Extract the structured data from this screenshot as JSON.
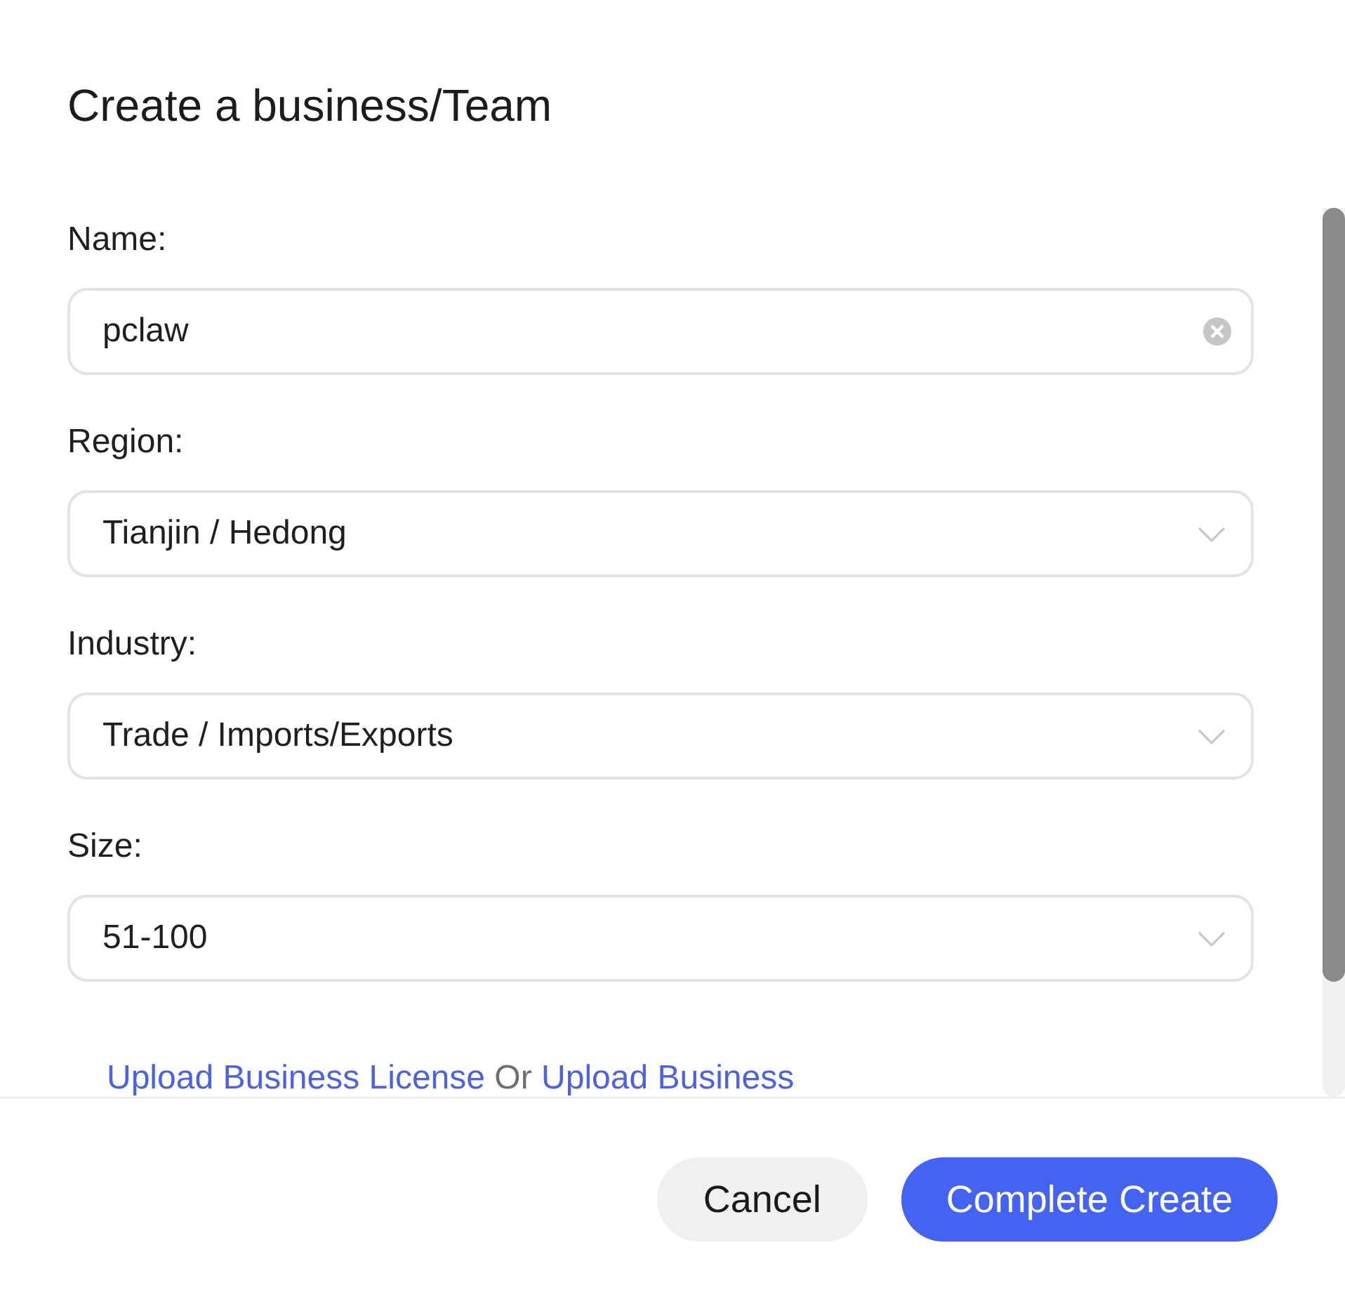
{
  "dialog": {
    "title": "Create a business/Team"
  },
  "fields": [
    {
      "kind": "text",
      "label": "Name:",
      "value": "pclaw"
    },
    {
      "kind": "select",
      "label": "Region:",
      "value": "Tianjin / Hedong"
    },
    {
      "kind": "select",
      "label": "Industry:",
      "value": "Trade / Imports/Exports"
    },
    {
      "kind": "select",
      "label": "Size:",
      "value": "51-100"
    }
  ],
  "upload_line": [
    {
      "kind": "link",
      "text": "Upload Business License"
    },
    {
      "kind": "text",
      "text": "Or"
    },
    {
      "kind": "link",
      "text": "Upload Business"
    }
  ],
  "buttons": [
    {
      "kind": "cancel",
      "label": "Cancel"
    },
    {
      "kind": "submit",
      "label": "Complete Create"
    }
  ]
}
